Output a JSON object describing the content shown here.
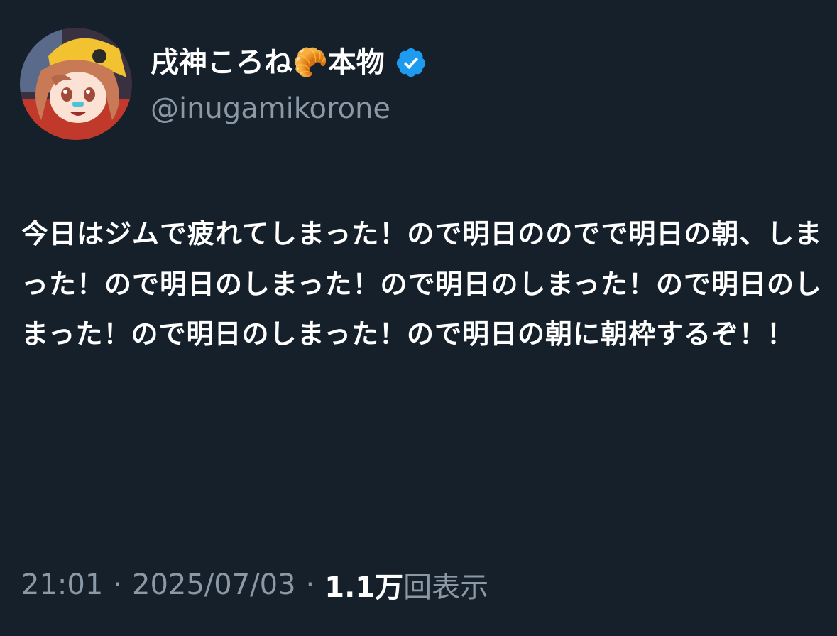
{
  "author": {
    "display_name": "戌神ころね",
    "name_emoji": "🥐",
    "name_suffix": "本物",
    "handle": "@inugamikorone",
    "verified": true,
    "verified_color": "#1d9bf0"
  },
  "tweet": {
    "text": "今日はジムで疲れてしまった！ので明日ののでで明日の朝、しまった！ので明日のしまった！ので明日のしまった！ので明日のしまった！ので明日のしまった！ので明日の朝に朝枠するぞ！！"
  },
  "meta": {
    "time": "21:01",
    "date": "2025/07/03",
    "separator": "·",
    "views_count": "1.1万",
    "views_label": "回表示"
  },
  "colors": {
    "background": "#15202b",
    "primary_text": "#ffffff",
    "secondary_text": "#8b98a5"
  }
}
